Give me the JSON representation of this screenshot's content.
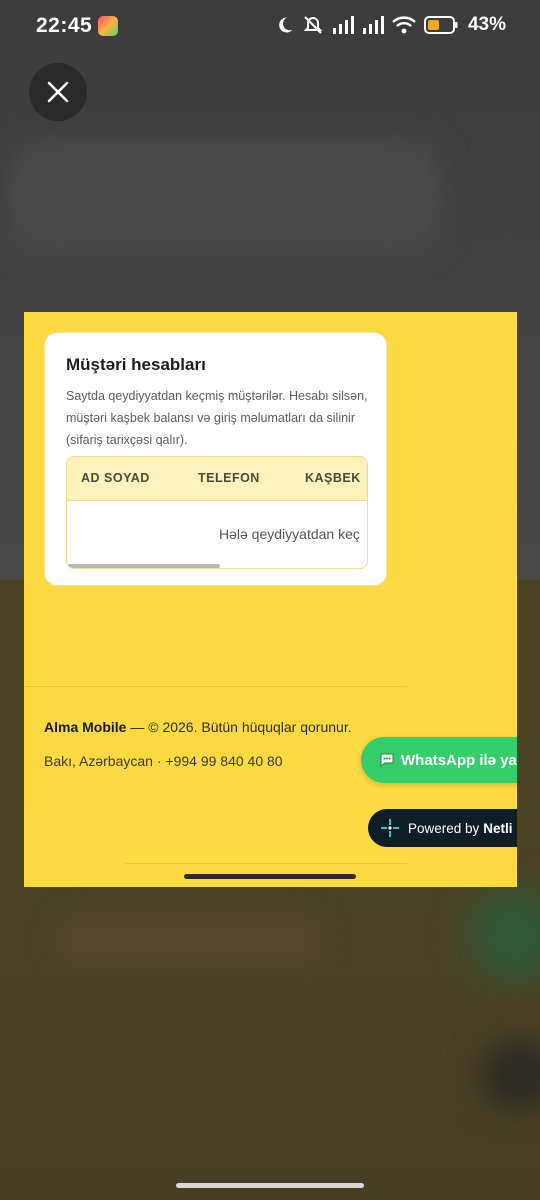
{
  "status_bar": {
    "time": "22:45",
    "battery": "43%",
    "icons": [
      "moon-icon",
      "mute-icon",
      "signal-icon",
      "signal-icon",
      "wifi-icon",
      "battery-icon"
    ]
  },
  "viewer": {
    "close_icon": "close-icon"
  },
  "panel": {
    "title": "Müştəri hesabları",
    "description": "Saytda qeydiyyatdan keçmiş müştərilər. Hesabı silsən, müştəri kaşbek balansı və giriş məlumatları da silinir (sifariş tarixçəsi qalır).",
    "table": {
      "columns": [
        "AD SOYAD",
        "TELEFON",
        "KAŞBEK"
      ],
      "empty_message": "Hələ qeydiyyatdan keç"
    }
  },
  "footer": {
    "brand": "Alma Mobile",
    "copyright": " — © 2026. Bütün hüquqlar qorunur.",
    "contact": "Bakı, Azərbaycan · +994 99 840 40 80"
  },
  "whatsapp": {
    "label": "WhatsApp ilə ya",
    "icon": "chat-bubble-icon"
  },
  "netlify": {
    "prefix": "Powered by",
    "brand": "Netli"
  },
  "colors": {
    "page_yellow": "#fdda40",
    "whatsapp_green": "#34cf6a",
    "netlify_dark": "#0e1e25"
  }
}
